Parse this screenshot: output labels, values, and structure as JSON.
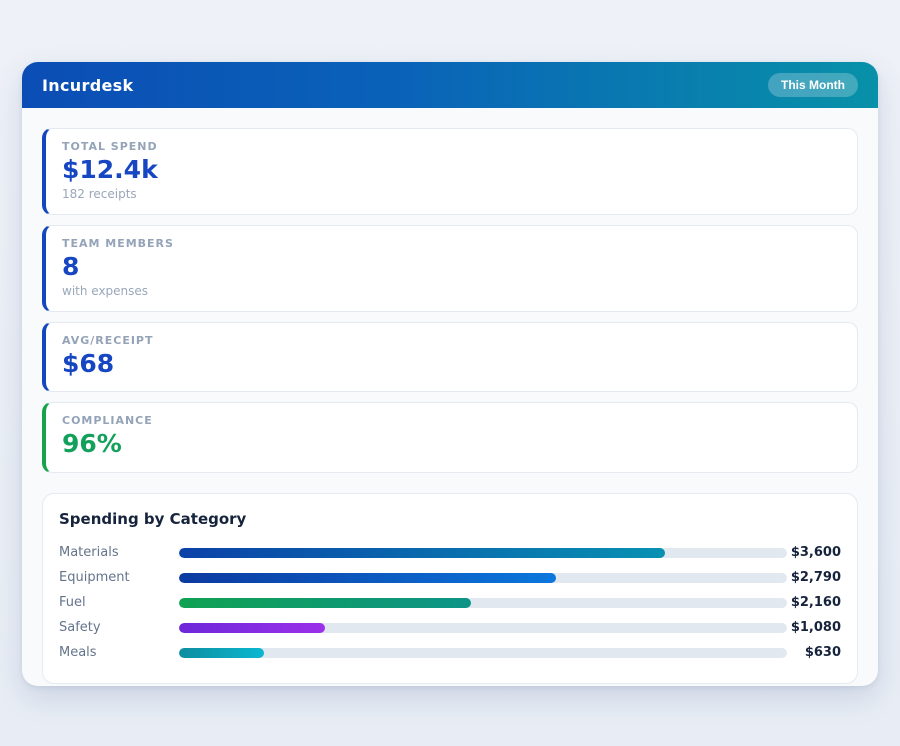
{
  "header": {
    "title": "Incurdesk",
    "badge_label": "This Month"
  },
  "colors": {
    "header_gradient_start": "#0b4db5",
    "header_gradient_end": "#0891a8",
    "stat_accent_blue": "#1347be",
    "stat_accent_green": "#16a34a",
    "stat_value_blue": "#1646c2",
    "stat_value_green": "#12a05a",
    "track": "#e2e8f0",
    "value_text": "#16233c",
    "label_text": "#64748b"
  },
  "stats": [
    {
      "label": "TOTAL SPEND",
      "value": "$12.4k",
      "sub": "182 receipts",
      "accent": "#1347be",
      "value_color": "#1646c2"
    },
    {
      "label": "TEAM MEMBERS",
      "value": "8",
      "sub": "with expenses",
      "accent": "#1347be",
      "value_color": "#1646c2"
    },
    {
      "label": "AVG/RECEIPT",
      "value": "$68",
      "sub": "",
      "accent": "#1347be",
      "value_color": "#1646c2"
    },
    {
      "label": "COMPLIANCE",
      "value": "96%",
      "sub": "",
      "accent": "#16a34a",
      "value_color": "#12a05a"
    }
  ],
  "chart_data": {
    "type": "bar",
    "title": "Spending by Category",
    "orientation": "horizontal",
    "categories": [
      "Materials",
      "Equipment",
      "Fuel",
      "Safety",
      "Meals"
    ],
    "values": [
      3600,
      2790,
      2160,
      1080,
      630
    ],
    "value_labels": [
      "$3,600",
      "$2,790",
      "$2,160",
      "$1,080",
      "$630"
    ],
    "axis_max": 4500,
    "grid": false,
    "legend": false,
    "bar_gradients": [
      [
        "#0b41a8",
        "#0891b2"
      ],
      [
        "#0c3aa0",
        "#0b77dd"
      ],
      [
        "#10a152",
        "#0d9488"
      ],
      [
        "#6d28d9",
        "#9b30ea"
      ],
      [
        "#0e8da0",
        "#0ab8d0"
      ]
    ]
  }
}
